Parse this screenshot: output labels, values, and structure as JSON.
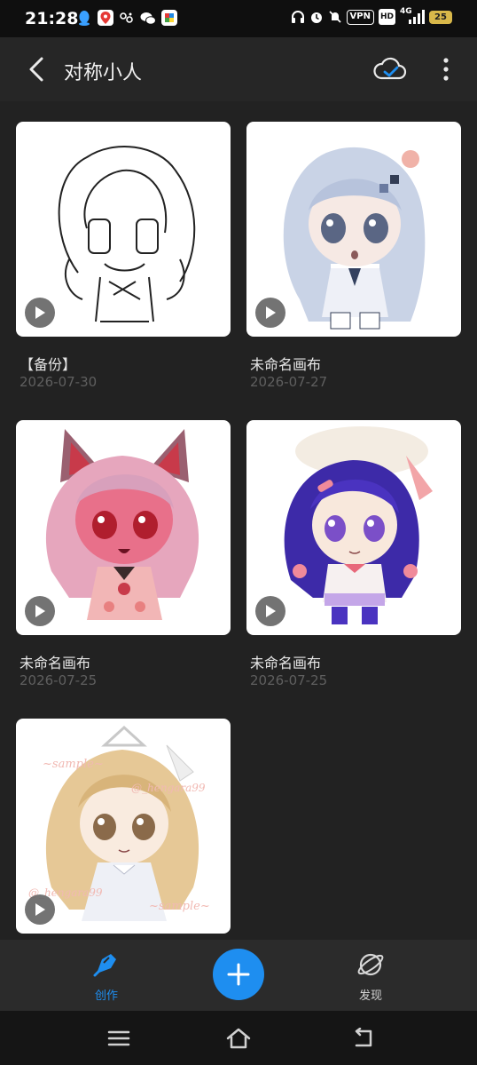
{
  "status_bar": {
    "time": "21:28",
    "left_icons": [
      "qq-icon",
      "map-pin-icon",
      "wind-icon",
      "wechat-icon",
      "app-icon"
    ],
    "vpn": "VPN",
    "hd": "HD",
    "network": "4G",
    "battery": "25"
  },
  "header": {
    "title": "对称小人"
  },
  "artworks": [
    {
      "name": "【备份】",
      "date": "2026-07-30"
    },
    {
      "name": "未命名画布",
      "date": "2026-07-27"
    },
    {
      "name": "未命名画布",
      "date": "2026-07-25"
    },
    {
      "name": "未命名画布",
      "date": "2026-07-25"
    },
    {
      "name": "",
      "date": ""
    }
  ],
  "watermark": {
    "sample_top": "~sample~",
    "handle": "@_hengara99",
    "sample_bottom": "~sample~"
  },
  "bottom_nav": {
    "create_label": "创作",
    "discover_label": "发现"
  },
  "colors": {
    "accent": "#1e8ef0",
    "background": "#222222"
  }
}
